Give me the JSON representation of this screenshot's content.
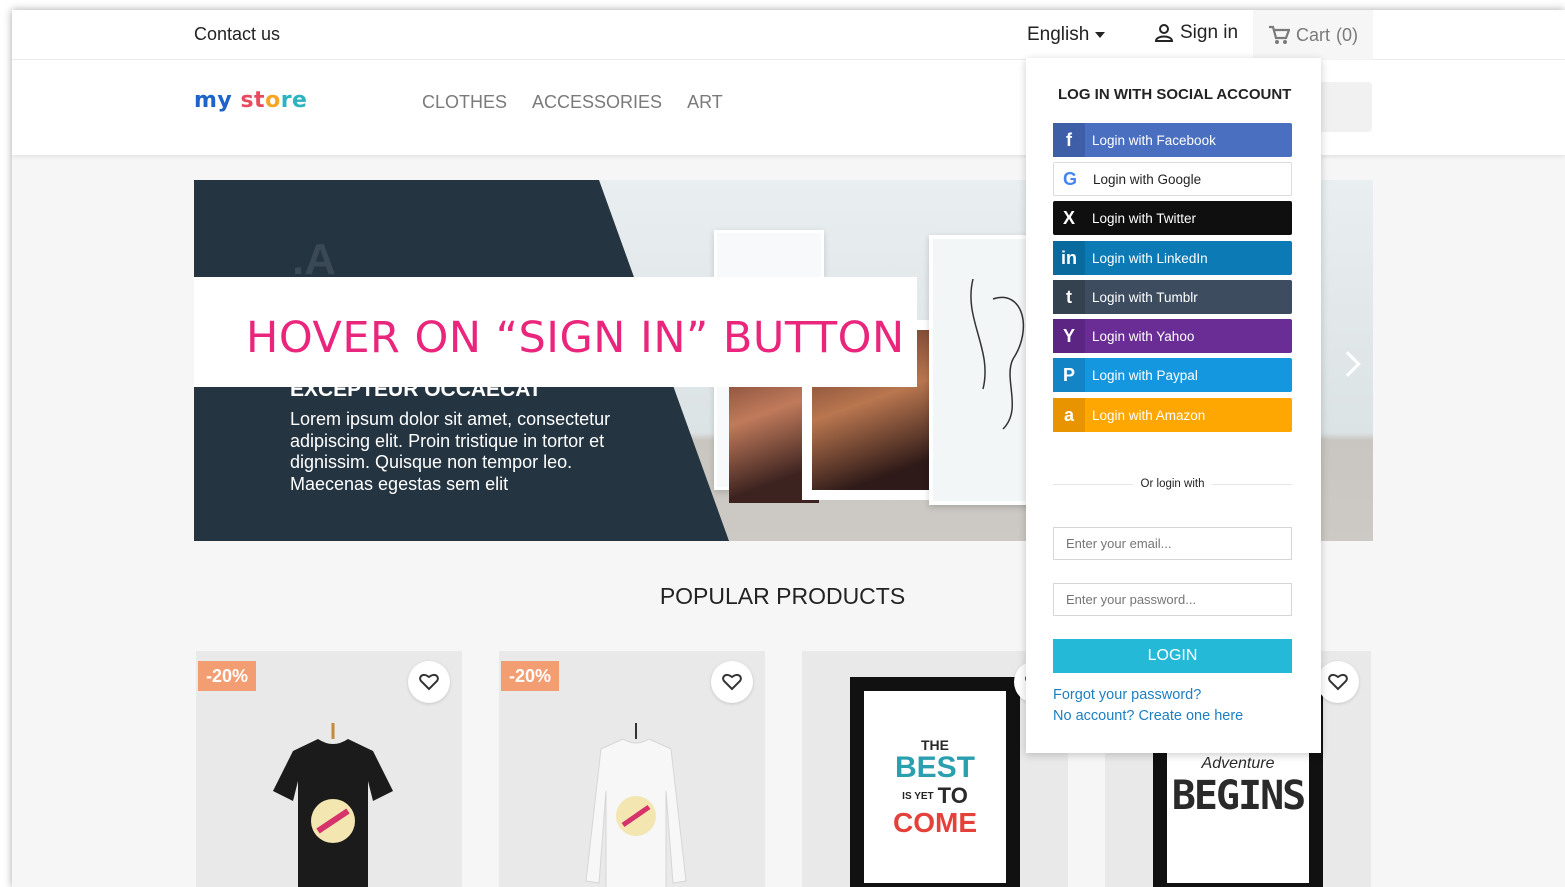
{
  "topbar": {
    "contact": "Contact us",
    "language": "English",
    "signin": "Sign in",
    "cart": "Cart",
    "cart_count": "(0)"
  },
  "logo": {
    "part1": "my",
    "part2": "st",
    "part3": "o",
    "part4": "re"
  },
  "nav": [
    "CLOTHES",
    "ACCESSORIES",
    "ART"
  ],
  "banner": {
    "overlay": "HOVER ON “SIGN IN” BUTTON",
    "title": "EXCEPTEUR OCCAECAT",
    "text": "Lorem ipsum dolor sit amet, consectetur adipiscing elit. Proin tristique in tortor et dignissim. Quisque non tempor leo. Maecenas egestas sem elit"
  },
  "popular": {
    "title": "POPULAR PRODUCTS"
  },
  "products": [
    {
      "badge": "-20%"
    },
    {
      "badge": "-20%"
    },
    {
      "poster_lines": [
        "THE",
        "BEST",
        "IS YET",
        "TO",
        "COME"
      ]
    },
    {
      "poster_lines": [
        "Adventure",
        "BEGINS"
      ]
    }
  ],
  "dropdown": {
    "title": "LOG IN WITH SOCIAL ACCOUNT",
    "social": [
      {
        "label": "Login with Facebook",
        "icon": "f"
      },
      {
        "label": "Login with Google",
        "icon": "G"
      },
      {
        "label": "Login with Twitter",
        "icon": "X"
      },
      {
        "label": "Login with LinkedIn",
        "icon": "in"
      },
      {
        "label": "Login with Tumblr",
        "icon": "t"
      },
      {
        "label": "Login with Yahoo",
        "icon": "Y"
      },
      {
        "label": "Login with Paypal",
        "icon": "P"
      },
      {
        "label": "Login with Amazon",
        "icon": "a"
      }
    ],
    "divider": "Or login with",
    "email_placeholder": "Enter your email...",
    "password_placeholder": "Enter your password...",
    "login": "LOGIN",
    "forgot": "Forgot your password?",
    "create": "No account? Create one here"
  }
}
